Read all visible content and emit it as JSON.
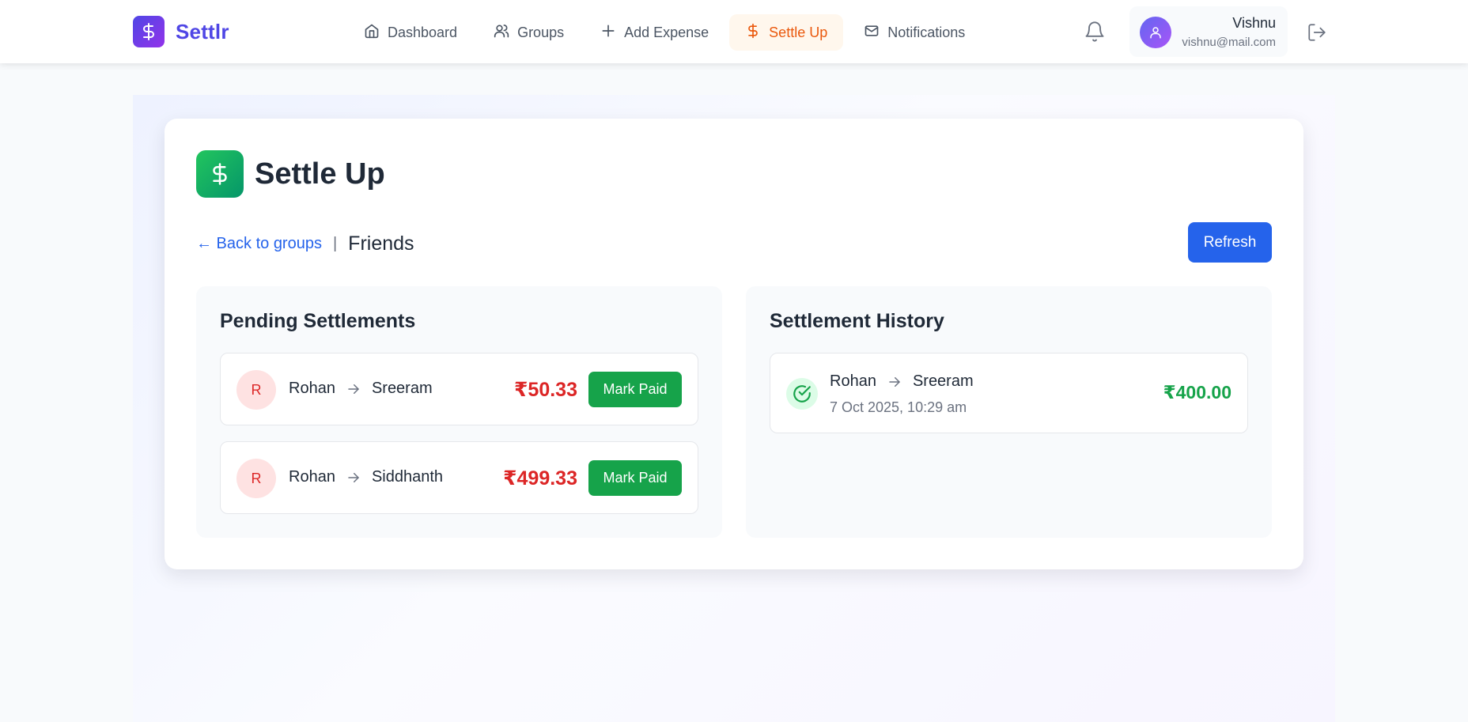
{
  "brand": {
    "name": "Settlr",
    "logo_icon": "dollar-icon"
  },
  "nav": {
    "items": [
      {
        "label": "Dashboard",
        "icon": "home-icon",
        "active": false
      },
      {
        "label": "Groups",
        "icon": "users-icon",
        "active": false
      },
      {
        "label": "Add Expense",
        "icon": "plus-icon",
        "active": false
      },
      {
        "label": "Settle Up",
        "icon": "dollar-icon",
        "active": true
      },
      {
        "label": "Notifications",
        "icon": "mail-icon",
        "active": false
      }
    ]
  },
  "user": {
    "name": "Vishnu",
    "email": "vishnu@mail.com"
  },
  "page": {
    "title": "Settle Up",
    "back_link": "← Back to groups",
    "separator": "|",
    "group_name": "Friends",
    "refresh_label": "Refresh"
  },
  "pending": {
    "title": "Pending Settlements",
    "items": [
      {
        "initial": "R",
        "from": "Rohan",
        "to": "Sreeram",
        "amount": "₹50.33",
        "action": "Mark Paid"
      },
      {
        "initial": "R",
        "from": "Rohan",
        "to": "Siddhanth",
        "amount": "₹499.33",
        "action": "Mark Paid"
      }
    ]
  },
  "history": {
    "title": "Settlement History",
    "items": [
      {
        "from": "Rohan",
        "to": "Sreeram",
        "date": "7 Oct 2025, 10:29 am",
        "amount": "₹400.00"
      }
    ]
  },
  "colors": {
    "brand": "#4f46e5",
    "active_nav": "#ea580c",
    "primary_button": "#2563eb",
    "success": "#16a34a",
    "owed": "#dc2626"
  }
}
